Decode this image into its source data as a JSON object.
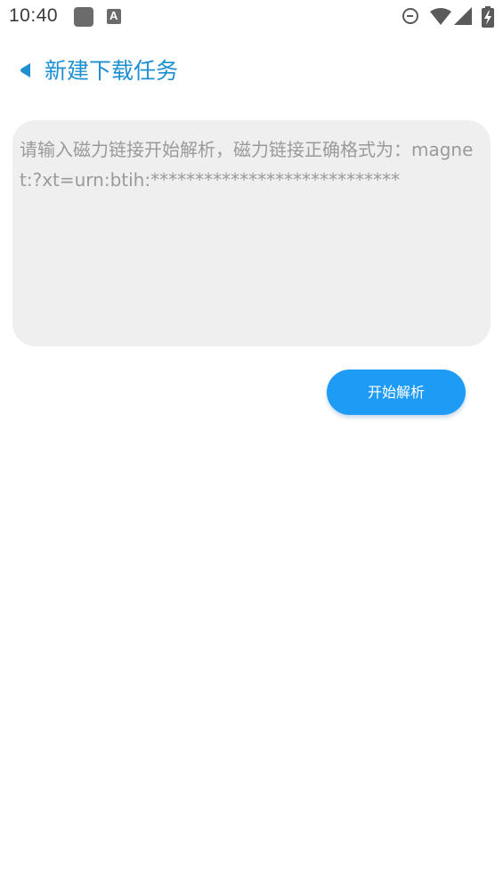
{
  "status_bar": {
    "time": "10:40",
    "notification_icons": [
      "app-notification-icon",
      "font-a-icon"
    ],
    "system_icons": [
      "do-not-disturb-icon",
      "wifi-icon",
      "cellular-signal-icon",
      "battery-charging-icon"
    ],
    "font_icon_letter": "A"
  },
  "header": {
    "back_icon": "back-triangle-icon",
    "title": "新建下载任务"
  },
  "magnet_input": {
    "value": "",
    "placeholder": "请输入磁力链接开始解析，磁力链接正确格式为：magnet:?xt=urn:btih:****************************"
  },
  "actions": {
    "start_parse_label": "开始解析"
  },
  "colors": {
    "accent": "#1e8fd0",
    "button": "#1e9bf4",
    "input_background": "#efefef",
    "placeholder_text": "#9a9a9a"
  }
}
